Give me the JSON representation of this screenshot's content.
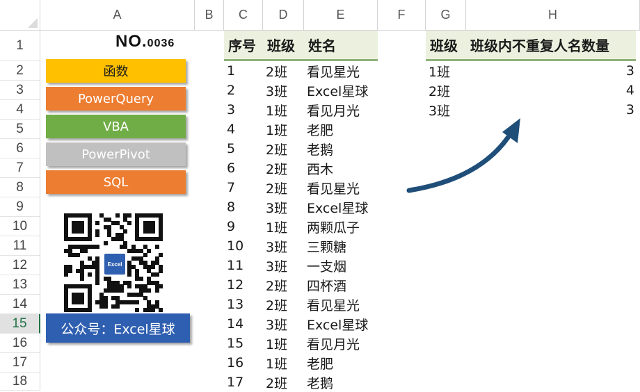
{
  "columns": [
    "A",
    "B",
    "C",
    "D",
    "E",
    "F",
    "G",
    "H"
  ],
  "rows": [
    "1",
    "2",
    "3",
    "4",
    "5",
    "6",
    "7",
    "8",
    "9",
    "10",
    "11",
    "12",
    "13",
    "14",
    "15",
    "16",
    "17",
    "18"
  ],
  "selected_row": "15",
  "panel": {
    "title_main": "NO.",
    "title_num": "0036",
    "buttons": [
      {
        "label": "函数",
        "bg": "#ffc000",
        "fg": "#1a1a1a"
      },
      {
        "label": "PowerQuery",
        "bg": "#ed7d31",
        "fg": "#ffffff"
      },
      {
        "label": "VBA",
        "bg": "#70ad47",
        "fg": "#ffffff"
      },
      {
        "label": "PowerPivot",
        "bg": "#c0c0c0",
        "fg": "#ffffff"
      },
      {
        "label": "SQL",
        "bg": "#ed7d31",
        "fg": "#ffffff"
      }
    ],
    "qr_logo": "Excel",
    "account_label": "公众号：Excel星球"
  },
  "source_table": {
    "headers": [
      "序号",
      "班级",
      "姓名"
    ],
    "rows": [
      [
        "1",
        "2班",
        "看见星光"
      ],
      [
        "2",
        "3班",
        "Excel星球"
      ],
      [
        "3",
        "1班",
        "看见月光"
      ],
      [
        "4",
        "1班",
        "老肥"
      ],
      [
        "5",
        "2班",
        "老鹅"
      ],
      [
        "6",
        "2班",
        "西木"
      ],
      [
        "7",
        "2班",
        "看见星光"
      ],
      [
        "8",
        "3班",
        "Excel星球"
      ],
      [
        "9",
        "1班",
        "两颗瓜子"
      ],
      [
        "10",
        "3班",
        "三颗糖"
      ],
      [
        "11",
        "3班",
        "一支烟"
      ],
      [
        "12",
        "2班",
        "四杯酒"
      ],
      [
        "13",
        "2班",
        "看见星光"
      ],
      [
        "14",
        "3班",
        "Excel星球"
      ],
      [
        "15",
        "1班",
        "看见月光"
      ],
      [
        "16",
        "1班",
        "老肥"
      ],
      [
        "17",
        "2班",
        "老鹅"
      ]
    ]
  },
  "result_table": {
    "headers": [
      "班级",
      "班级内不重复人名数量"
    ],
    "rows": [
      [
        "1班",
        "3"
      ],
      [
        "2班",
        "4"
      ],
      [
        "3班",
        "3"
      ]
    ]
  },
  "colors": {
    "arrow": "#1f4e79",
    "header_fill": "#ebf1de",
    "header_border": "#8fb07a",
    "account_bg": "#2f5fb0"
  }
}
